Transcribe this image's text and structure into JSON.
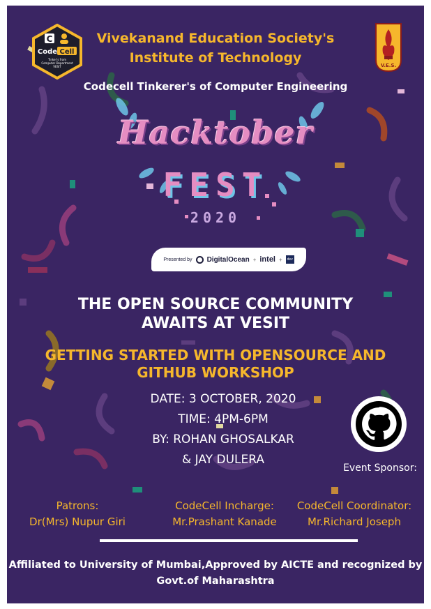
{
  "header": {
    "logo_left": {
      "title": "Code Cell",
      "tagline_lines": [
        "Tinker's from",
        "Computer Department",
        "VESIT"
      ]
    },
    "logo_right_text": "V.E.S.",
    "org_line1": "Vivekanand Education Society's",
    "org_line2": "Institute of Technology",
    "subtitle": "Codecell Tinkerer's of Computer Engineering"
  },
  "hero": {
    "title": "Hacktober",
    "fest": "FEST",
    "year": "2020",
    "presented_by": "Presented by",
    "sponsors": [
      "DigitalOcean",
      "intel",
      "dev"
    ]
  },
  "event": {
    "headline_line1": "THE OPEN SOURCE COMMUNITY",
    "headline_line2": "AWAITS AT VESIT",
    "workshop_line1": "GETTING STARTED WITH OPENSOURCE AND",
    "workshop_line2": "GITHUB WORKSHOP",
    "date": "DATE: 3 OCTOBER, 2020",
    "time": "TIME: 4PM-6PM",
    "by_line1": "BY: ROHAN GHOSALKAR",
    "by_line2": "& JAY DULERA",
    "sponsor_label": "Event Sponsor:"
  },
  "credits": [
    {
      "title": "Patrons:",
      "name": "Dr(Mrs) Nupur Giri"
    },
    {
      "title": "CodeCell Incharge:",
      "name": "Mr.Prashant Kanade"
    },
    {
      "title": "CodeCell Coordinator:",
      "name": "Mr.Richard Joseph"
    }
  ],
  "footer": {
    "line1": "Affiliated to University of Mumbai,Approved by AICTE and recognized by",
    "line2": "Govt.of Maharashtra"
  },
  "colors": {
    "background": "#3a2563",
    "accent": "#f6b72c",
    "text": "#ffffff",
    "hero_pink": "#e58dc2"
  },
  "icons": [
    "codecell-logo",
    "ves-logo",
    "github-icon",
    "digitalocean-icon",
    "dev-icon"
  ]
}
